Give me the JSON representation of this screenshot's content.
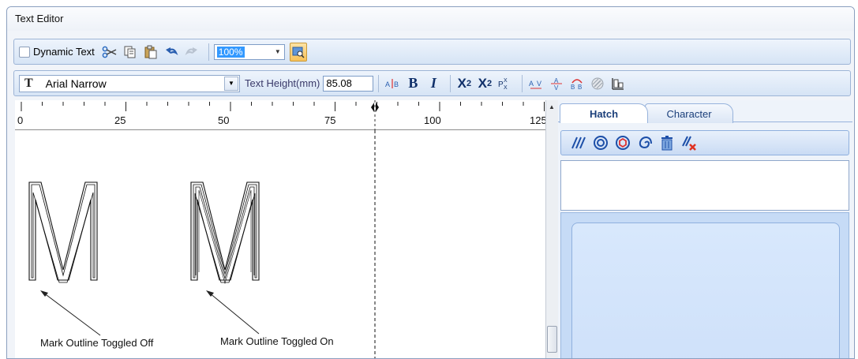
{
  "window": {
    "title": "Text Editor"
  },
  "toolbar_main": {
    "dynamic_text_label": "Dynamic Text",
    "zoom_value": "100%",
    "icons": [
      "scissors-icon",
      "copy-icon",
      "paste-icon",
      "undo-icon",
      "redo-icon",
      "preview-icon"
    ]
  },
  "toolbar_font": {
    "font_name": "Arial Narrow",
    "text_height_label": "Text Height(mm)",
    "text_height_value": "85.08",
    "icons": [
      "char-spacing-icon",
      "bold-icon",
      "italic-icon",
      "superscript-icon",
      "subscript-icon",
      "super-sub-icon",
      "letter-spacing-icon",
      "line-spacing-icon",
      "flip-icon",
      "outline-icon",
      "align-icon"
    ],
    "bold_glyph": "B",
    "italic_glyph": "I",
    "super_glyph": "X",
    "super_exp": "2",
    "sub_glyph": "X",
    "sub_exp": "2"
  },
  "ruler": {
    "labels": [
      "0",
      "25",
      "50",
      "75",
      "100",
      "125"
    ]
  },
  "canvas": {
    "glyph": "M",
    "annotations": [
      "Mark Outline Toggled Off",
      "Mark Outline Toggled On"
    ]
  },
  "right_panel": {
    "tabs": [
      "Hatch",
      "Character"
    ],
    "active_tab": "Hatch",
    "hatch_icons": [
      "hatch-lines-icon",
      "hatch-rings-icon",
      "hatch-hex-rings-icon",
      "hatch-spiral-icon",
      "delete-icon",
      "clear-hatch-icon"
    ]
  },
  "colors": {
    "accent": "#3399ff",
    "toolbar_border": "#9db4d6",
    "panel_blue": "#c6dbf6"
  }
}
